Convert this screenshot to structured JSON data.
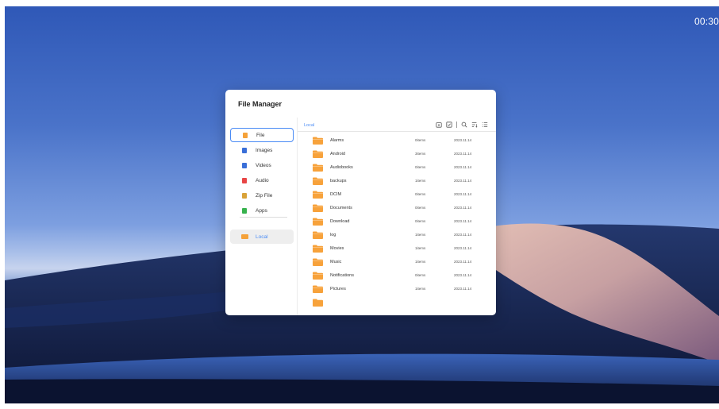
{
  "status_bar": {
    "clock": "00:30"
  },
  "window": {
    "title": "File Manager"
  },
  "sidebar": {
    "items": [
      {
        "label": "File",
        "icon": "document-icon",
        "color": "#f5a23a"
      },
      {
        "label": "Images",
        "icon": "image-icon",
        "color": "#3a6fd8"
      },
      {
        "label": "Videos",
        "icon": "video-icon",
        "color": "#3a6fd8"
      },
      {
        "label": "Audio",
        "icon": "audio-icon",
        "color": "#e84646"
      },
      {
        "label": "Zip File",
        "icon": "zip-icon",
        "color": "#d9a238"
      },
      {
        "label": "Apps",
        "icon": "android-icon",
        "color": "#37b24d"
      }
    ],
    "storage": {
      "label": "Local",
      "icon": "folder-icon",
      "color": "#f5a23a"
    }
  },
  "main": {
    "breadcrumb": "Local",
    "toolbar": [
      "new-folder-icon",
      "select-icon",
      "search-icon",
      "sort-icon",
      "list-view-icon"
    ],
    "files": [
      {
        "name": "Alarms",
        "count": "0items",
        "date": "2023.11.14"
      },
      {
        "name": "Android",
        "count": "3items",
        "date": "2023.11.14"
      },
      {
        "name": "Audiobooks",
        "count": "0items",
        "date": "2023.11.14"
      },
      {
        "name": "backups",
        "count": "1items",
        "date": "2023.11.14"
      },
      {
        "name": "DCIM",
        "count": "0items",
        "date": "2023.11.14"
      },
      {
        "name": "Documents",
        "count": "0items",
        "date": "2023.11.14"
      },
      {
        "name": "Download",
        "count": "0items",
        "date": "2023.11.14"
      },
      {
        "name": "log",
        "count": "1items",
        "date": "2023.11.14"
      },
      {
        "name": "Movies",
        "count": "1items",
        "date": "2023.11.14"
      },
      {
        "name": "Music",
        "count": "1items",
        "date": "2023.11.14"
      },
      {
        "name": "Notifications",
        "count": "0items",
        "date": "2023.11.14"
      },
      {
        "name": "Pictures",
        "count": "1items",
        "date": "2023.11.14"
      }
    ],
    "folder_color": "#f7a23b"
  }
}
